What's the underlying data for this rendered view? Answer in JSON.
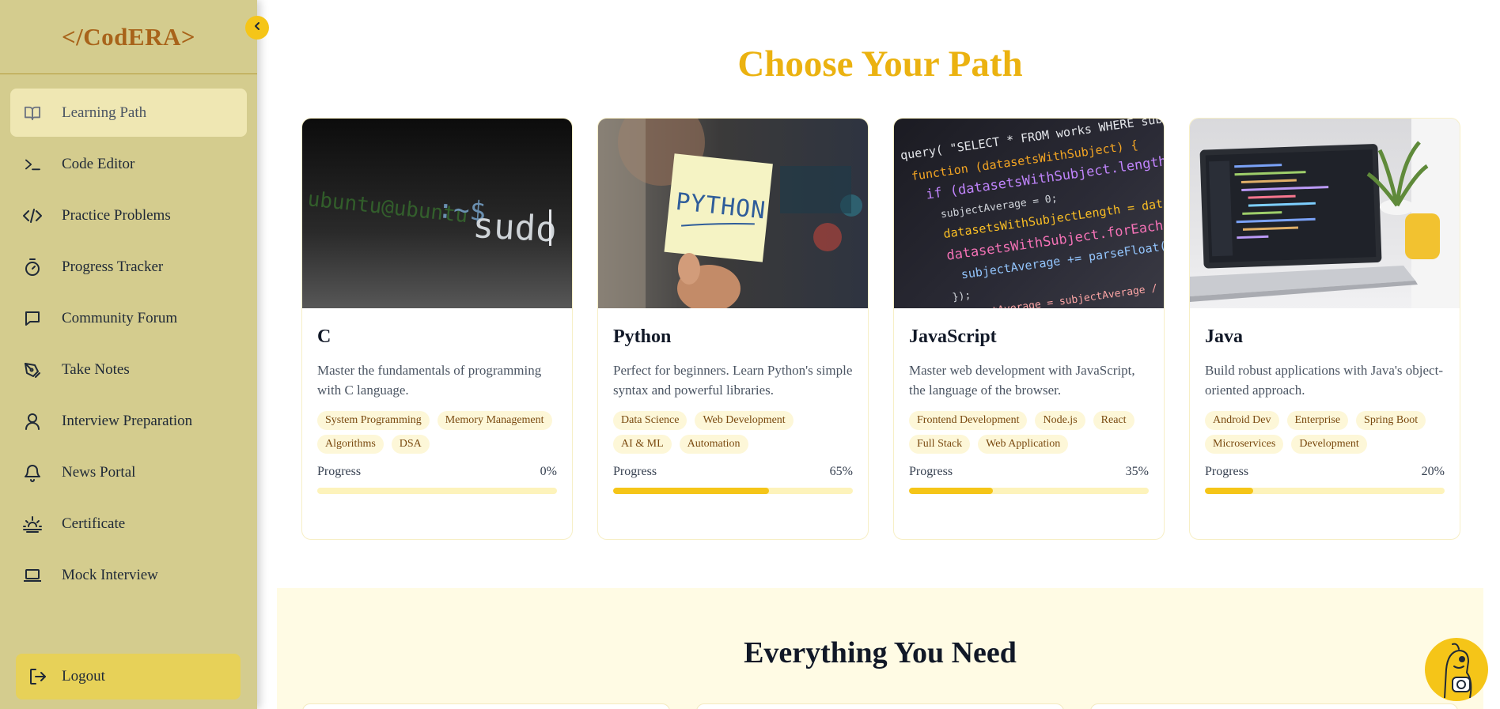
{
  "brand": {
    "logo_text": "</CodERA>"
  },
  "sidebar": {
    "collapse_icon": "chevron-left-icon",
    "items": [
      {
        "label": "Learning Path",
        "icon": "book-open-icon",
        "active": true
      },
      {
        "label": "Code Editor",
        "icon": "terminal-icon",
        "active": false
      },
      {
        "label": "Practice Problems",
        "icon": "code-icon",
        "active": false
      },
      {
        "label": "Progress Tracker",
        "icon": "timer-icon",
        "active": false
      },
      {
        "label": "Community Forum",
        "icon": "message-square-icon",
        "active": false
      },
      {
        "label": "Take Notes",
        "icon": "pen-tool-icon",
        "active": false
      },
      {
        "label": "Interview Preparation",
        "icon": "user-icon",
        "active": false
      },
      {
        "label": "News Portal",
        "icon": "bell-icon",
        "active": false
      },
      {
        "label": "Certificate",
        "icon": "sunrise-icon",
        "active": false
      },
      {
        "label": "Mock Interview",
        "icon": "laptop-icon",
        "active": false
      }
    ],
    "logout_label": "Logout"
  },
  "main": {
    "section_title": "Choose Your Path",
    "cards": [
      {
        "title": "C",
        "description": "Master the fundamentals of programming with C language.",
        "image": "terminal-sudo-image",
        "tags": [
          "System Programming",
          "Memory Management",
          "Algorithms",
          "DSA"
        ],
        "progress_label": "Progress",
        "progress_text": "0%",
        "progress_value": 0
      },
      {
        "title": "Python",
        "description": "Perfect for beginners. Learn Python's simple syntax and powerful libraries.",
        "image": "python-sticky-note-image",
        "tags": [
          "Data Science",
          "Web Development",
          "AI & ML",
          "Automation"
        ],
        "progress_label": "Progress",
        "progress_text": "65%",
        "progress_value": 65
      },
      {
        "title": "JavaScript",
        "description": "Master web development with JavaScript, the language of the browser.",
        "image": "javascript-code-image",
        "tags": [
          "Frontend Development",
          "Node.js",
          "React",
          "Full Stack",
          "Web Application"
        ],
        "progress_label": "Progress",
        "progress_text": "35%",
        "progress_value": 35
      },
      {
        "title": "Java",
        "description": "Build robust applications with Java's object-oriented approach.",
        "image": "laptop-desk-image",
        "tags": [
          "Android Dev",
          "Enterprise",
          "Spring Boot",
          "Microservices",
          "Development"
        ],
        "progress_label": "Progress",
        "progress_text": "20%",
        "progress_value": 20
      }
    ],
    "features_title": "Everything You Need"
  },
  "chatbot": {
    "icon": "robot-assistant-icon"
  },
  "colors": {
    "sidebar_bg": "#d4cc8e",
    "brand_text": "#a8631a",
    "accent_yellow": "#f5c518",
    "title_gold": "#ebb210",
    "active_item_bg": "#efe7b3",
    "logout_bg": "#e7d158",
    "tag_bg": "#fdf7d8",
    "progress_track": "#fdf3bb"
  }
}
